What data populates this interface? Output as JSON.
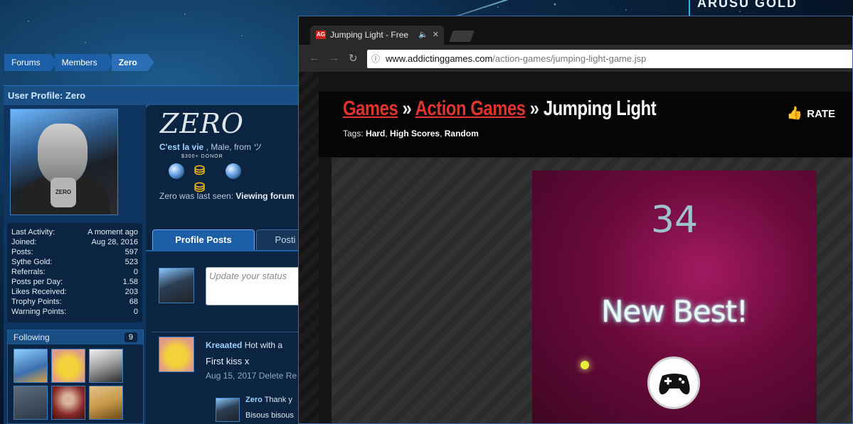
{
  "brand_banner": "ARUSU GOLD",
  "breadcrumb": [
    "Forums",
    "Members",
    "Zero"
  ],
  "profile": {
    "header": "User Profile: Zero",
    "display_name": "ZERO",
    "tagline": "C'est la vie",
    "gender_prefix": ", Male,",
    "from_label": "from",
    "from_value": "ツ",
    "donor_badge": "$300+ DONOR",
    "avatar_text": "ZERO",
    "last_seen_prefix": "Zero was last seen:",
    "last_seen_value": "Viewing forum",
    "stats": [
      {
        "label": "Last Activity:",
        "value": "A moment ago"
      },
      {
        "label": "Joined:",
        "value": "Aug 28, 2016"
      },
      {
        "label": "Posts:",
        "value": "597"
      },
      {
        "label": "Sythe Gold:",
        "value": "523"
      },
      {
        "label": "Referrals:",
        "value": "0"
      },
      {
        "label": "Posts per Day:",
        "value": "1.58"
      },
      {
        "label": "Likes Received:",
        "value": "203"
      },
      {
        "label": "Trophy Points:",
        "value": "68"
      },
      {
        "label": "Warning Points:",
        "value": "0"
      }
    ],
    "following_label": "Following",
    "following_count": "9",
    "following_avatars": [
      "#3b6fb0",
      "#e9c22a",
      "#d8d8d8",
      "#3a4b5c",
      "#8a2b2b",
      "#c99a4a"
    ],
    "tabs": [
      "Profile Posts",
      "Posti"
    ],
    "status_placeholder": "Update your status",
    "post": {
      "author": "Kreaated",
      "text_preview": "Hot with a",
      "body": "First kiss x",
      "date": "Aug 15, 2017",
      "action_delete": "Delete",
      "action_more": "Re"
    },
    "comment": {
      "author": "Zero",
      "text_preview": "Thank y",
      "body": "Bisous bisous"
    }
  },
  "browser": {
    "tab_title": "Jumping Light - Free",
    "url_host": "www.addictinggames.com",
    "url_path": "/action-games/jumping-light-game.jsp",
    "favicon_text": "AG",
    "page": {
      "crumb_games": "Games",
      "crumb_action": "Action Games",
      "separator": "»",
      "current": "Jumping Light",
      "tags_label": "Tags:",
      "tags": [
        "Hard",
        "High Scores",
        "Random"
      ],
      "rate_label": "RATE",
      "game": {
        "score": "34",
        "message": "New Best!"
      }
    }
  },
  "colors": {
    "accent_blue": "#1d5fa6",
    "link_red": "#e0342c",
    "game_magenta": "#a21a60"
  }
}
